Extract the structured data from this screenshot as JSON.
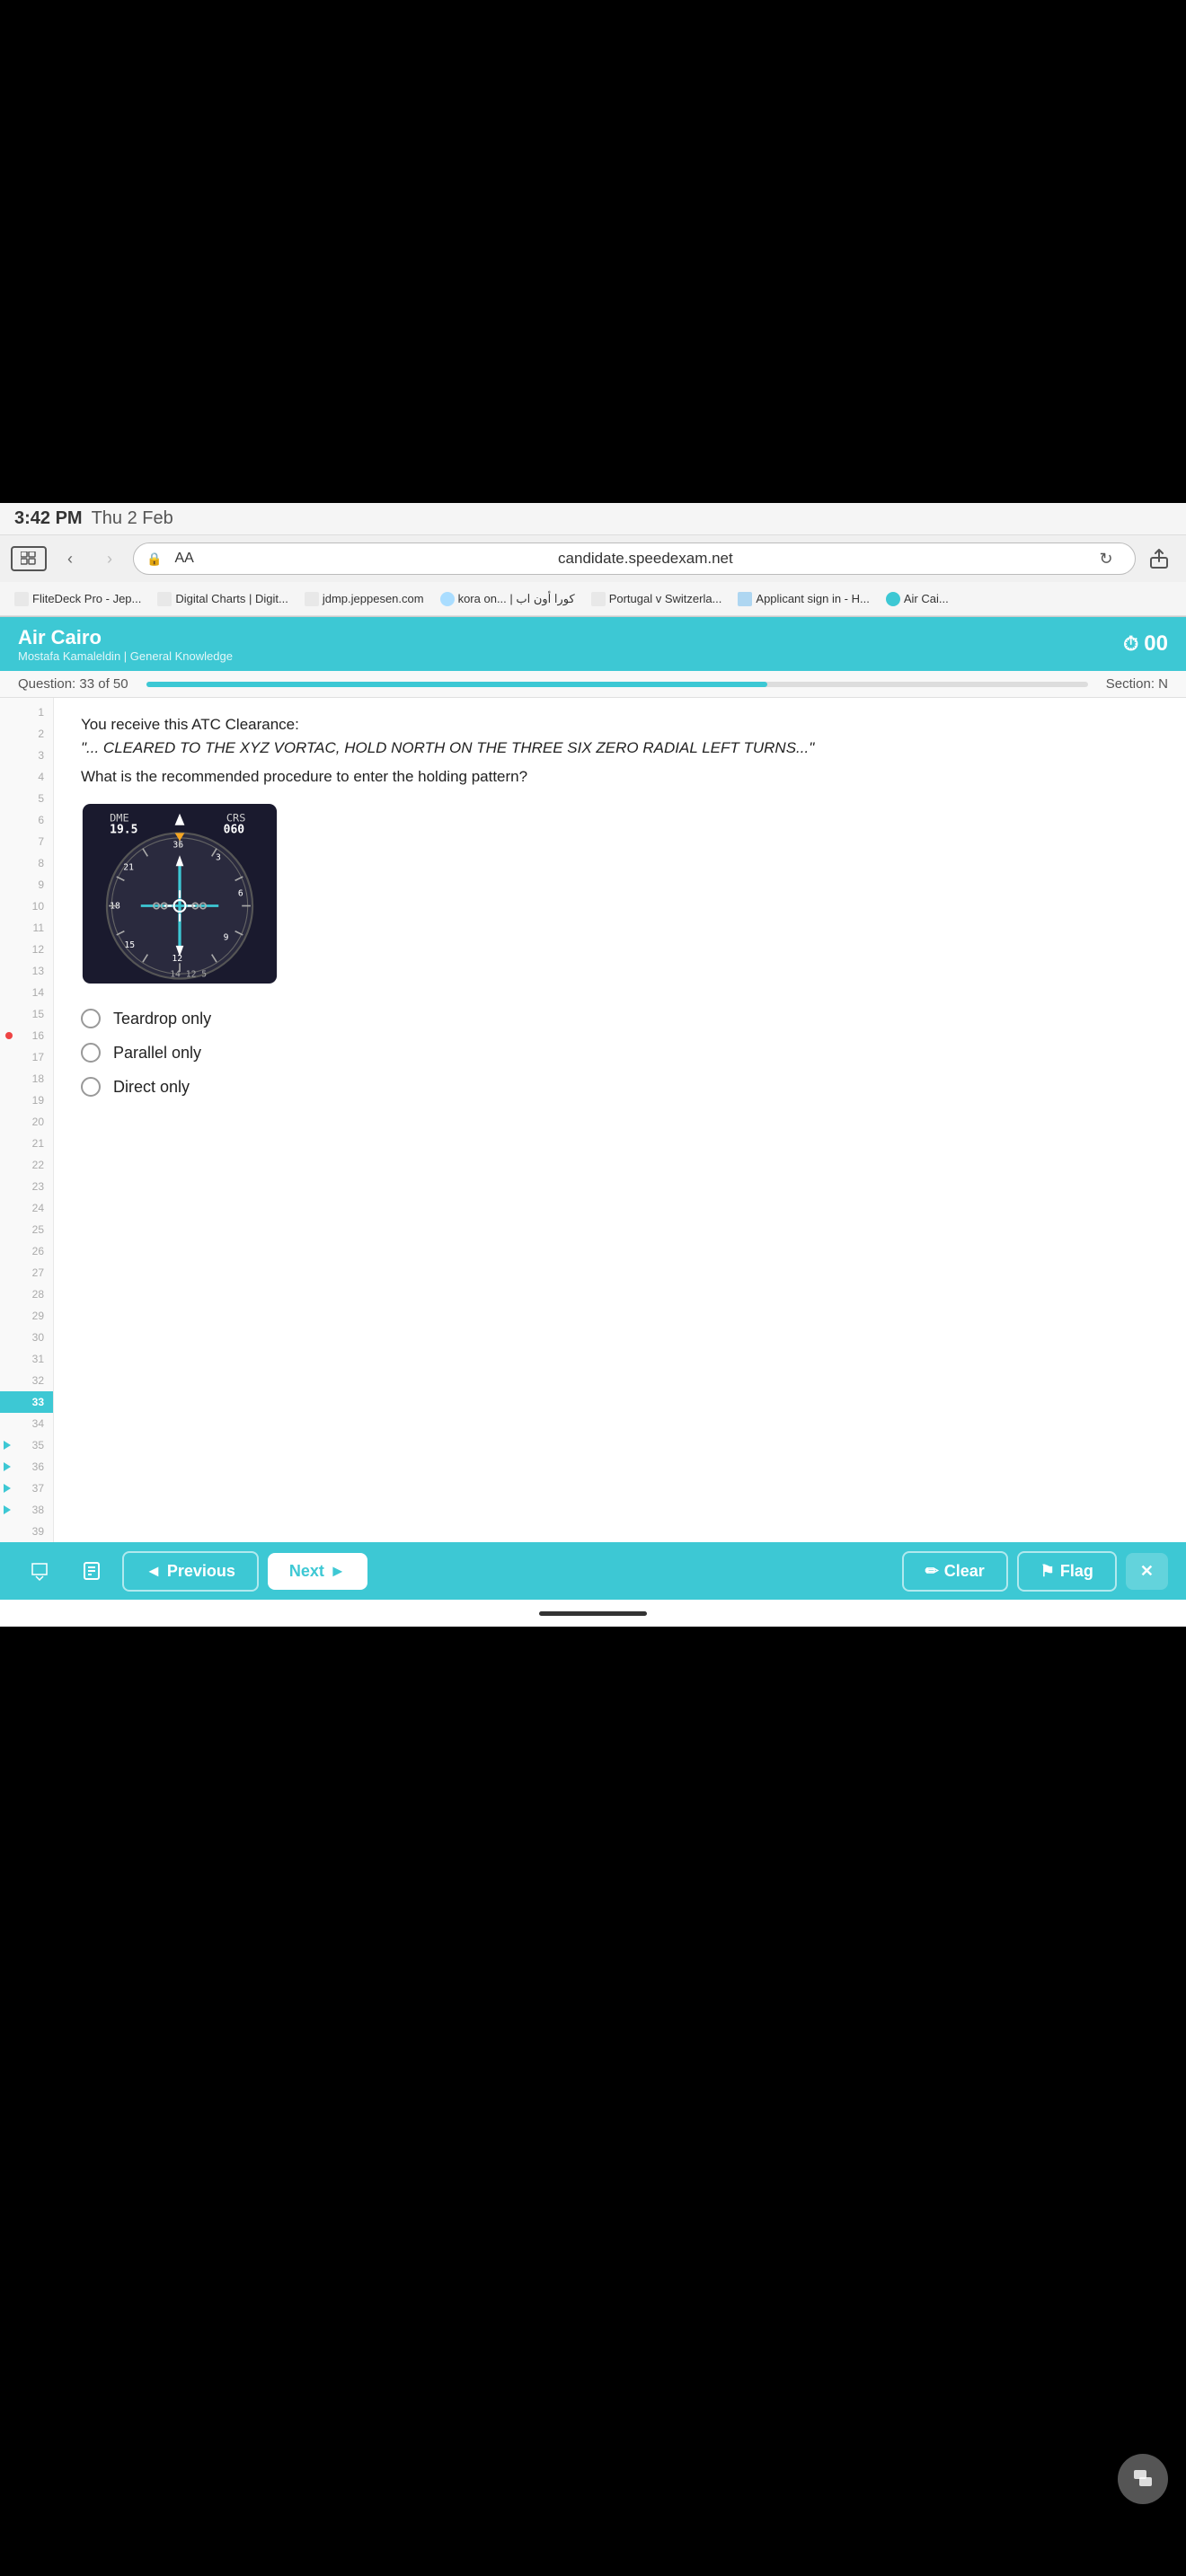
{
  "status_bar": {
    "time": "3:42 PM",
    "date": "Thu 2 Feb"
  },
  "browser": {
    "aa_label": "AA",
    "address": "candidate.speedexam.net",
    "bookmarks": [
      {
        "label": "FliteDeck Pro - Jep..."
      },
      {
        "label": "Digital Charts | Digit..."
      },
      {
        "label": "jdmp.jeppesen.com"
      },
      {
        "label": "kora on... | كورا أون اب"
      },
      {
        "label": "Portugal v Switzerla..."
      },
      {
        "label": "Applicant sign in - H..."
      },
      {
        "label": "Air Cai..."
      }
    ]
  },
  "app": {
    "title": "Air Cairo",
    "subtitle": "Mostafa Kamaleldin | General Knowledge",
    "timer": "00",
    "timer_icon": "⏱"
  },
  "question": {
    "label": "Question: 33 of 50",
    "progress_percent": 66,
    "section": "Section: N",
    "clearance_label": "You receive this ATC Clearance:",
    "clearance_text": "\"... CLEARED TO THE XYZ VORTAC, HOLD NORTH ON THE THREE SIX ZERO RADIAL LEFT TURNS...\"",
    "question_text": "What is the recommended procedure to enter the holding pattern?",
    "hsi": {
      "dme_label": "DME",
      "dme_value": "19.5",
      "crs_label": "CRS",
      "crs_value": "060"
    },
    "options": [
      {
        "id": "opt1",
        "label": "Teardrop only",
        "selected": false
      },
      {
        "id": "opt2",
        "label": "Parallel only",
        "selected": false
      },
      {
        "id": "opt3",
        "label": "Direct only",
        "selected": false
      }
    ]
  },
  "nav": {
    "prev_label": "Previous",
    "next_label": "Next",
    "clear_label": "Clear",
    "flag_label": "Flag"
  },
  "line_numbers": {
    "total": 39,
    "active": 33,
    "flag_line": 16
  }
}
